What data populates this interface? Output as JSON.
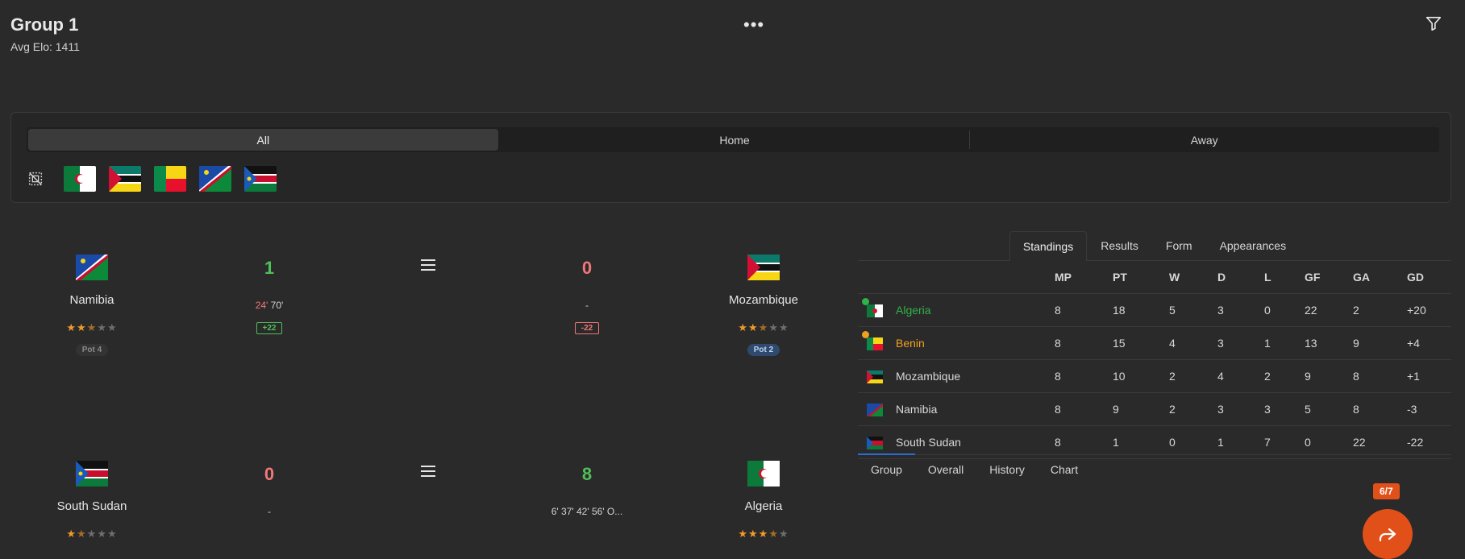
{
  "header": {
    "title": "Group 1",
    "subtitle": "Avg Elo: 1411"
  },
  "filter": {
    "segments": [
      "All",
      "Home",
      "Away"
    ],
    "active_segment": "All",
    "flags": [
      "algeria-flag",
      "mozambique-flag",
      "benin-flag",
      "namibia-flag",
      "south-sudan-flag"
    ]
  },
  "matches": [
    {
      "home": {
        "name": "Namibia",
        "rating": 2.5,
        "pot": "Pot 4"
      },
      "home_score": "1",
      "home_goals_a": "24'",
      "home_goals_b": "70'",
      "home_diff": "+22",
      "away": {
        "name": "Mozambique",
        "rating": 2.5,
        "pot": "Pot 2"
      },
      "away_score": "0",
      "away_goals": "-",
      "away_diff": "-22"
    },
    {
      "home": {
        "name": "South Sudan",
        "rating": 1.5
      },
      "home_score": "0",
      "home_goals": "-",
      "away": {
        "name": "Algeria",
        "rating": 3.5
      },
      "away_score": "8",
      "away_goals": "6' 37' 42' 56' O..."
    }
  ],
  "standings": {
    "tabs": [
      "Standings",
      "Results",
      "Form",
      "Appearances"
    ],
    "active_tab": "Standings",
    "columns": [
      "MP",
      "PT",
      "W",
      "D",
      "L",
      "GF",
      "GA",
      "GD"
    ],
    "rows": [
      {
        "team": "Algeria",
        "mp": "8",
        "pt": "18",
        "w": "5",
        "d": "3",
        "l": "0",
        "gf": "22",
        "ga": "2",
        "gd": "+20"
      },
      {
        "team": "Benin",
        "mp": "8",
        "pt": "15",
        "w": "4",
        "d": "3",
        "l": "1",
        "gf": "13",
        "ga": "9",
        "gd": "+4"
      },
      {
        "team": "Mozambique",
        "mp": "8",
        "pt": "10",
        "w": "2",
        "d": "4",
        "l": "2",
        "gf": "9",
        "ga": "8",
        "gd": "+1"
      },
      {
        "team": "Namibia",
        "mp": "8",
        "pt": "9",
        "w": "2",
        "d": "3",
        "l": "3",
        "gf": "5",
        "ga": "8",
        "gd": "-3"
      },
      {
        "team": "South Sudan",
        "mp": "8",
        "pt": "1",
        "w": "0",
        "d": "1",
        "l": "7",
        "gf": "0",
        "ga": "22",
        "gd": "-22"
      }
    ],
    "bottom_tabs": [
      "Group",
      "Overall",
      "History",
      "Chart"
    ],
    "active_bottom_tab": "Group"
  },
  "progress_badge": "6/7",
  "colors": {
    "accent": "#e2501a",
    "win": "#4fbf5a",
    "loss": "#f07878",
    "qualified": "#2fb34a",
    "playoff": "#f0a020",
    "pot2": "#2f4a6e"
  }
}
